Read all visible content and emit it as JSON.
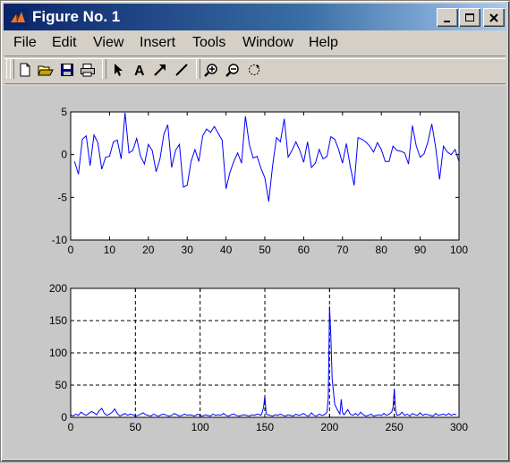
{
  "window": {
    "title": "Figure No. 1"
  },
  "menu": [
    {
      "label": "File"
    },
    {
      "label": "Edit"
    },
    {
      "label": "View"
    },
    {
      "label": "Insert"
    },
    {
      "label": "Tools"
    },
    {
      "label": "Window"
    },
    {
      "label": "Help"
    }
  ],
  "toolbar": {
    "icons": [
      "new-figure-icon",
      "open-file-icon",
      "save-icon",
      "print-icon",
      "select-arrow-icon",
      "insert-text-icon",
      "insert-arrow-icon",
      "insert-line-icon",
      "zoom-in-icon",
      "zoom-out-icon",
      "rotate-3d-icon"
    ]
  },
  "chart_data": [
    {
      "type": "line",
      "title": "",
      "xlabel": "",
      "ylabel": "",
      "xlim": [
        0,
        100
      ],
      "ylim": [
        -10,
        5
      ],
      "xticks": [
        0,
        10,
        20,
        30,
        40,
        50,
        60,
        70,
        80,
        90,
        100
      ],
      "yticks": [
        -10,
        -5,
        0,
        5
      ],
      "grid": false,
      "color": "#0000ff",
      "series": [
        {
          "x": [
            1,
            2,
            3,
            4,
            5,
            6,
            7,
            8,
            9,
            10,
            11,
            12,
            13,
            14,
            15,
            16,
            17,
            18,
            19,
            20,
            21,
            22,
            23,
            24,
            25,
            26,
            27,
            28,
            29,
            30,
            31,
            32,
            33,
            34,
            35,
            36,
            37,
            38,
            39,
            40,
            41,
            42,
            43,
            44,
            45,
            46,
            47,
            48,
            49,
            50,
            51,
            52,
            53,
            54,
            55,
            56,
            57,
            58,
            59,
            60,
            61,
            62,
            63,
            64,
            65,
            66,
            67,
            68,
            69,
            70,
            71,
            72,
            73,
            74,
            75,
            76,
            77,
            78,
            79,
            80,
            81,
            82,
            83,
            84,
            85,
            86,
            87,
            88,
            89,
            90,
            91,
            92,
            93,
            94,
            95,
            96,
            97,
            98,
            99,
            100
          ],
          "values": [
            -0.8,
            -2.3,
            1.8,
            2.2,
            -1.3,
            2.3,
            1.4,
            -1.7,
            -0.3,
            -0.2,
            1.5,
            1.7,
            -0.5,
            4.9,
            0.2,
            0.5,
            1.9,
            -0.2,
            -1.1,
            1.2,
            0.5,
            -2.0,
            -0.5,
            2.4,
            3.5,
            -1.5,
            0.5,
            1.2,
            -3.8,
            -3.6,
            -0.8,
            0.6,
            -0.8,
            2.2,
            3.0,
            2.6,
            3.3,
            2.5,
            1.7,
            -4.0,
            -2.1,
            -0.8,
            0.2,
            -1.0,
            4.5,
            1.2,
            -0.4,
            -0.2,
            -1.6,
            -2.7,
            -5.5,
            -1.3,
            2.0,
            1.5,
            4.2,
            -0.3,
            0.5,
            1.5,
            0.5,
            -0.9,
            1.5,
            -1.5,
            -1.0,
            0.6,
            -0.5,
            -0.2,
            2.1,
            1.8,
            0.6,
            -1.0,
            1.3,
            -1.4,
            -3.6,
            2.0,
            1.8,
            1.5,
            1.0,
            0.3,
            1.4,
            0.6,
            -0.8,
            -0.8,
            1.0,
            0.5,
            0.4,
            0.2,
            -1.1,
            3.4,
            1.0,
            -0.3,
            0.1,
            1.5,
            3.6,
            0.8,
            -2.9,
            1.0,
            0.3,
            0.0,
            0.6,
            -0.8
          ]
        }
      ]
    },
    {
      "type": "line",
      "title": "",
      "xlabel": "",
      "ylabel": "",
      "xlim": [
        0,
        300
      ],
      "ylim": [
        0,
        200
      ],
      "xticks": [
        0,
        50,
        100,
        150,
        200,
        250,
        300
      ],
      "yticks": [
        0,
        50,
        100,
        150,
        200
      ],
      "grid": true,
      "color": "#0000ff",
      "series": [
        {
          "x": [
            0,
            2,
            4,
            6,
            8,
            10,
            12,
            14,
            16,
            18,
            20,
            22,
            24,
            26,
            28,
            30,
            32,
            34,
            36,
            38,
            40,
            42,
            44,
            46,
            48,
            50,
            52,
            54,
            56,
            58,
            60,
            62,
            64,
            66,
            68,
            70,
            72,
            74,
            76,
            78,
            80,
            82,
            84,
            86,
            88,
            90,
            92,
            94,
            96,
            98,
            100,
            102,
            104,
            106,
            108,
            110,
            112,
            114,
            116,
            118,
            120,
            122,
            124,
            126,
            128,
            130,
            132,
            134,
            136,
            138,
            140,
            142,
            144,
            146,
            147,
            148,
            149,
            150,
            151,
            152,
            154,
            156,
            158,
            160,
            162,
            164,
            166,
            168,
            170,
            172,
            174,
            176,
            178,
            180,
            182,
            184,
            186,
            188,
            190,
            192,
            194,
            196,
            198,
            199,
            200,
            201,
            202,
            204,
            206,
            208,
            209,
            210,
            211,
            212,
            214,
            216,
            218,
            220,
            222,
            224,
            226,
            228,
            230,
            232,
            234,
            236,
            238,
            240,
            242,
            244,
            246,
            248,
            249,
            250,
            251,
            252,
            254,
            256,
            258,
            260,
            262,
            264,
            266,
            268,
            270,
            272,
            274,
            276,
            278,
            280,
            282,
            284,
            286,
            288,
            290,
            292,
            294,
            296,
            298
          ],
          "values": [
            4,
            2,
            5,
            3,
            8,
            5,
            3,
            6,
            9,
            7,
            4,
            10,
            14,
            6,
            3,
            5,
            8,
            13,
            6,
            2,
            4,
            6,
            3,
            5,
            4,
            2,
            3,
            5,
            7,
            4,
            3,
            2,
            5,
            3,
            2,
            4,
            5,
            3,
            2,
            3,
            6,
            4,
            2,
            3,
            5,
            3,
            4,
            3,
            2,
            5,
            3,
            2,
            4,
            3,
            2,
            5,
            3,
            4,
            3,
            6,
            3,
            2,
            4,
            5,
            3,
            2,
            3,
            4,
            3,
            2,
            4,
            3,
            5,
            4,
            3,
            8,
            15,
            33,
            6,
            4,
            3,
            2,
            4,
            3,
            5,
            3,
            2,
            4,
            3,
            2,
            5,
            3,
            4,
            6,
            3,
            2,
            7,
            3,
            2,
            5,
            3,
            4,
            8,
            30,
            172,
            125,
            60,
            20,
            12,
            5,
            28,
            8,
            4,
            6,
            12,
            5,
            3,
            6,
            3,
            8,
            4,
            2,
            3,
            5,
            2,
            3,
            4,
            3,
            6,
            3,
            5,
            8,
            15,
            44,
            12,
            3,
            4,
            8,
            3,
            5,
            2,
            6,
            4,
            3,
            7,
            3,
            5,
            4,
            3,
            2,
            6,
            3,
            4,
            5,
            3,
            6,
            3,
            5,
            4
          ]
        }
      ]
    }
  ]
}
